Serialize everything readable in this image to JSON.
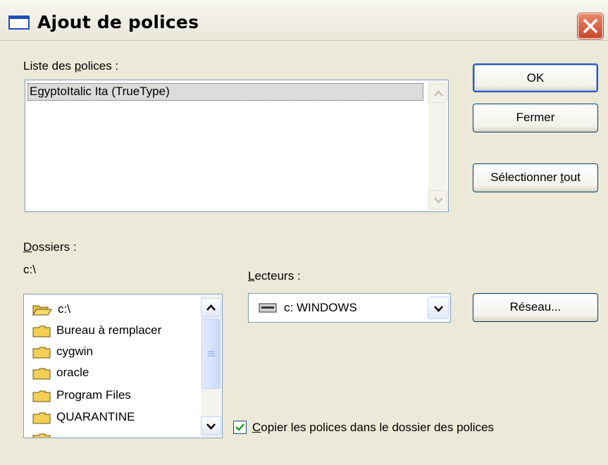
{
  "window": {
    "title": "Ajout de polices",
    "close_icon": "close-icon"
  },
  "fonts_list": {
    "label_prefix": "Liste des ",
    "label_access": "p",
    "label_suffix": "olices :",
    "items": [
      "EgyptoItalic Ita (TrueType)"
    ]
  },
  "buttons": {
    "ok": "OK",
    "close": "Fermer",
    "select_all_prefix": "Sélectionner ",
    "select_all_access": "t",
    "select_all_suffix": "out",
    "network": "Réseau..."
  },
  "folders": {
    "label_access": "D",
    "label_suffix": "ossiers :",
    "current_path": "c:\\",
    "items": [
      "c:\\",
      "Bureau à remplacer",
      "cygwin",
      "oracle",
      "Program Files",
      "QUARANTINE"
    ]
  },
  "drives": {
    "label_access": "L",
    "label_suffix": "ecteurs :",
    "selected": "c: WINDOWS"
  },
  "copy_option": {
    "checked": true,
    "label_access": "C",
    "label_suffix": "opier les polices dans le dossier des polices"
  },
  "colors": {
    "title_close": "#c9462b",
    "focus_border": "#2d56c0"
  }
}
